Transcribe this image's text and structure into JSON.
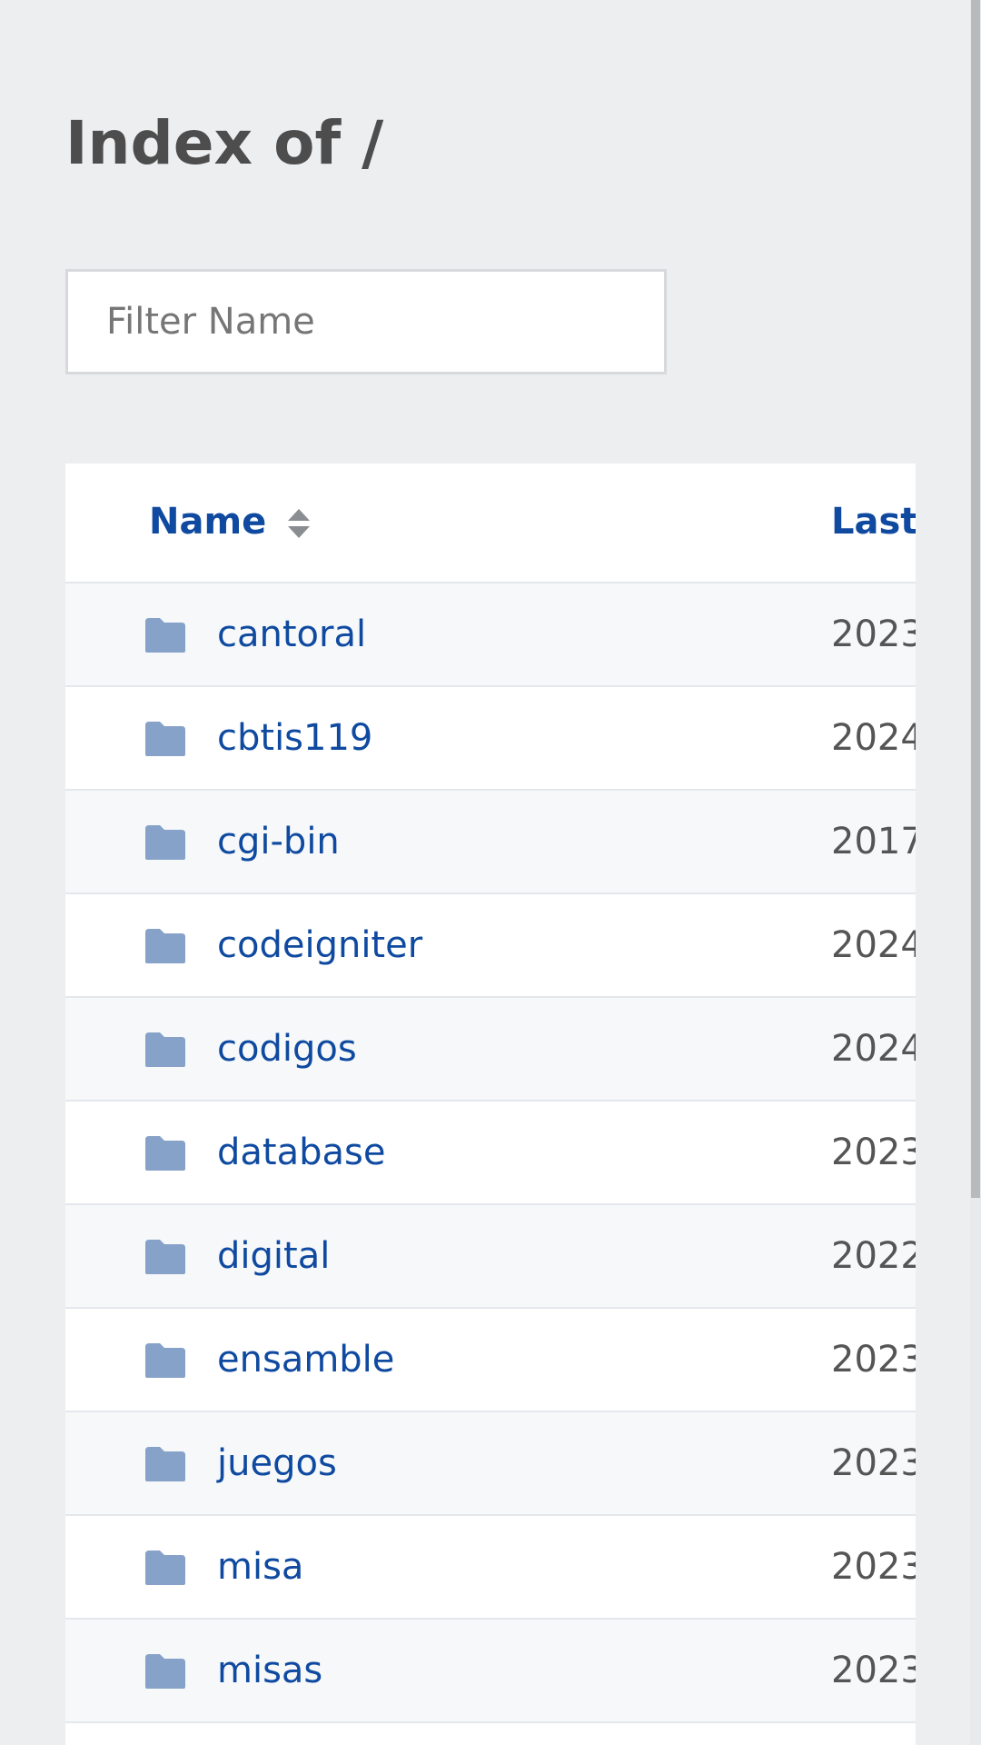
{
  "page": {
    "title": "Index of /"
  },
  "filter": {
    "placeholder": "Filter Name",
    "value": ""
  },
  "table": {
    "columns": {
      "name": "Name",
      "last_modified": "Last"
    },
    "rows": [
      {
        "name": "cantoral",
        "date": "2023",
        "icon": "folder-icon"
      },
      {
        "name": "cbtis119",
        "date": "2024",
        "icon": "folder-icon"
      },
      {
        "name": "cgi-bin",
        "date": "2017",
        "icon": "folder-icon"
      },
      {
        "name": "codeigniter",
        "date": "2024",
        "icon": "folder-icon"
      },
      {
        "name": "codigos",
        "date": "2024",
        "icon": "folder-icon"
      },
      {
        "name": "database",
        "date": "2023",
        "icon": "folder-icon"
      },
      {
        "name": "digital",
        "date": "2022",
        "icon": "folder-icon"
      },
      {
        "name": "ensamble",
        "date": "2023",
        "icon": "folder-icon"
      },
      {
        "name": "juegos",
        "date": "2023",
        "icon": "folder-icon"
      },
      {
        "name": "misa",
        "date": "2023",
        "icon": "folder-icon"
      },
      {
        "name": "misas",
        "date": "2023",
        "icon": "folder-icon"
      }
    ]
  },
  "colors": {
    "link": "#0f4aa0",
    "folder": "#87a2c9",
    "title": "#4d4d4d",
    "background": "#eceef0"
  }
}
